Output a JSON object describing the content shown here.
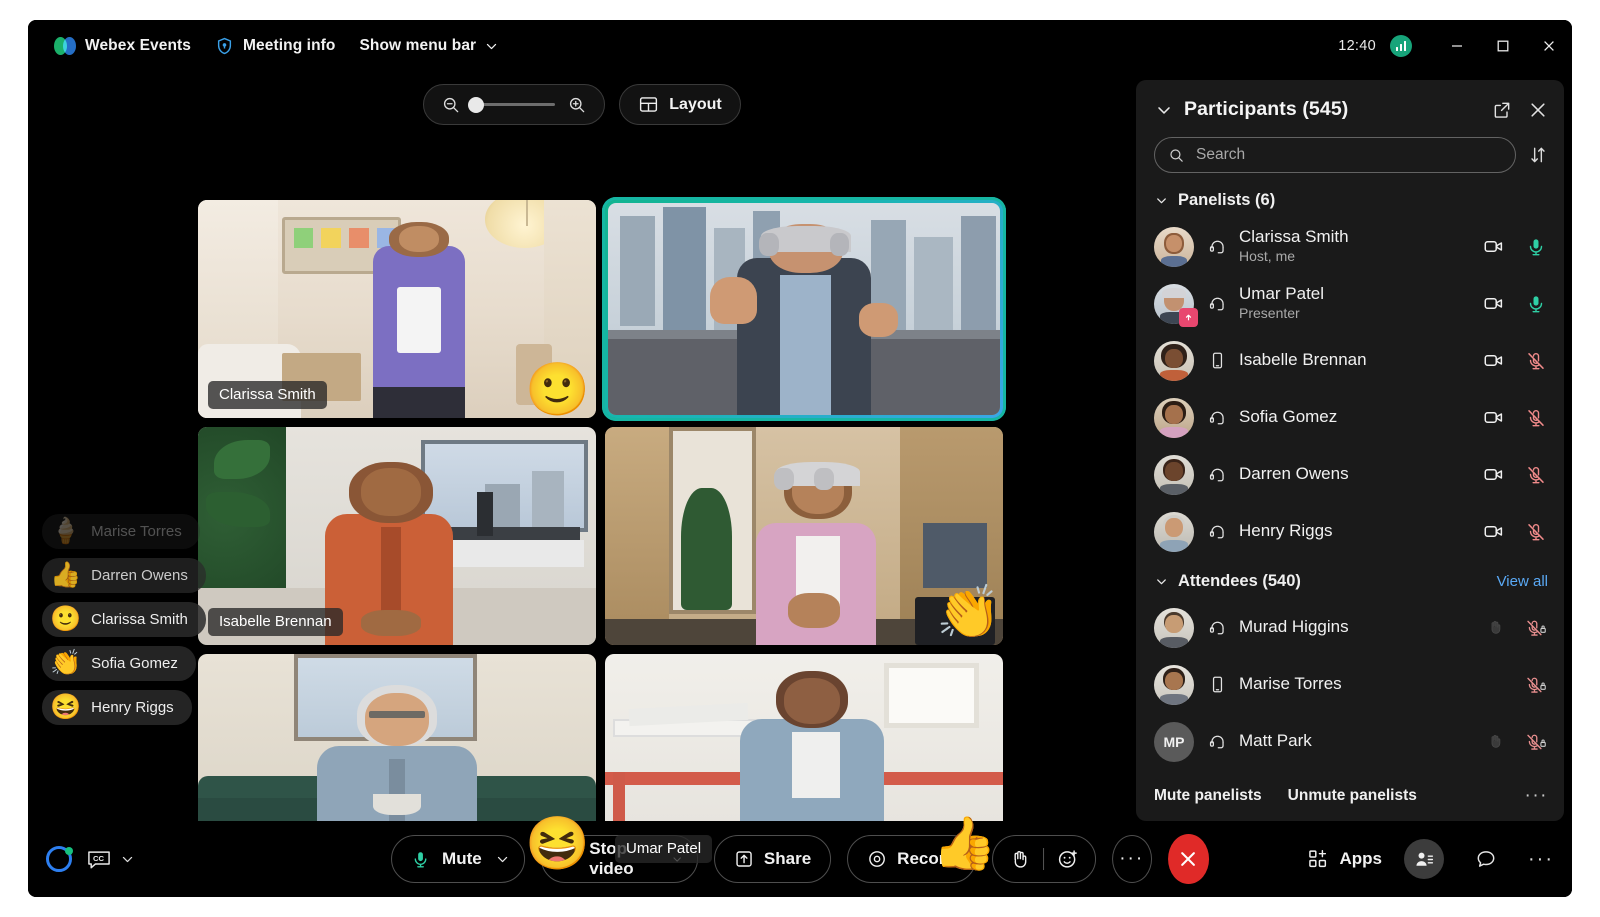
{
  "titlebar": {
    "app_name": "Webex Events",
    "meeting_info": "Meeting info",
    "menu_bar": "Show menu bar",
    "clock": "12:40",
    "network_icon": "network-quality-icon",
    "minimize_icon": "minimize-icon",
    "maximize_icon": "maximize-icon",
    "close_icon": "close-icon"
  },
  "stage": {
    "zoom": {
      "out_icon": "zoom-out-icon",
      "in_icon": "zoom-in-icon",
      "value": 0
    },
    "layout_label": "Layout",
    "tiles": [
      {
        "name": "Clarissa Smith",
        "show_name": true,
        "reaction": "🙂",
        "active": false
      },
      {
        "name": "Umar Patel",
        "show_name": false,
        "reaction": "",
        "active": true
      },
      {
        "name": "Isabelle Brennan",
        "show_name": true,
        "reaction": "",
        "active": false
      },
      {
        "name": "Sofia Gomez",
        "show_name": false,
        "reaction": "👏",
        "active": false
      },
      {
        "name": "Henry Riggs",
        "show_name": false,
        "reaction": "😆",
        "active": false
      },
      {
        "name": "Umar Patel",
        "show_name": true,
        "reaction": "👍",
        "active": false
      }
    ],
    "toasts": [
      {
        "emoji": "🍦",
        "name": "Marise Torres"
      },
      {
        "emoji": "👍",
        "name": "Darren Owens"
      },
      {
        "emoji": "🙂",
        "name": "Clarissa Smith"
      },
      {
        "emoji": "👏",
        "name": "Sofia Gomez"
      },
      {
        "emoji": "😆",
        "name": "Henry Riggs"
      }
    ]
  },
  "panel": {
    "title": "Participants (545)",
    "collapse_icon": "chevron-down-icon",
    "popout_icon": "open-in-new-icon",
    "close_icon": "close-icon",
    "search_placeholder": "Search",
    "search_value": "",
    "sort_icon": "sort-icon",
    "panelists_title": "Panelists (6)",
    "attendees_title": "Attendees (540)",
    "view_all": "View all",
    "panelists": [
      {
        "name": "Clarissa Smith",
        "role": "Host, me",
        "device": "headset",
        "camera": "on",
        "mic": "active",
        "presenter": false,
        "hand": false
      },
      {
        "name": "Umar Patel",
        "role": "Presenter",
        "device": "headset",
        "camera": "on",
        "mic": "active",
        "presenter": true,
        "hand": false
      },
      {
        "name": "Isabelle Brennan",
        "role": "",
        "device": "mobile",
        "camera": "on",
        "mic": "muted",
        "presenter": false,
        "hand": false
      },
      {
        "name": "Sofia Gomez",
        "role": "",
        "device": "headset",
        "camera": "on",
        "mic": "muted",
        "presenter": false,
        "hand": false
      },
      {
        "name": "Darren Owens",
        "role": "",
        "device": "headset",
        "camera": "on",
        "mic": "muted",
        "presenter": false,
        "hand": false
      },
      {
        "name": "Henry Riggs",
        "role": "",
        "device": "headset",
        "camera": "on",
        "mic": "muted",
        "presenter": false,
        "hand": false
      }
    ],
    "attendees": [
      {
        "name": "Murad Higgins",
        "initials": "",
        "device": "headset",
        "mic": "muted-locked",
        "hand": true
      },
      {
        "name": "Marise Torres",
        "initials": "",
        "device": "mobile",
        "mic": "muted-locked",
        "hand": false
      },
      {
        "name": "Matt Park",
        "initials": "MP",
        "device": "headset",
        "mic": "muted-locked",
        "hand": true
      }
    ],
    "mute_panelists": "Mute panelists",
    "unmute_panelists": "Unmute panelists",
    "more_label": "···"
  },
  "bottombar": {
    "assistant_icon": "webex-assistant-icon",
    "captions_icon": "closed-captions-icon",
    "mute_label": "Mute",
    "video_label": "Stop video",
    "share_label": "Share",
    "record_label": "Record",
    "hand_icon": "raise-hand-icon",
    "reactions_icon": "reactions-icon",
    "more_label": "···",
    "end_icon": "end-meeting-icon",
    "apps_label": "Apps",
    "participants_icon": "participants-icon",
    "chat_icon": "chat-icon",
    "more_right_label": "···"
  },
  "colors": {
    "accent_teal": "#16b6a3",
    "mic_active": "#2fd0a5",
    "mic_muted": "#f08a8a",
    "end_red": "#e02a28",
    "link_blue": "#5aa9f5",
    "panel_bg": "#1a1a1a"
  }
}
